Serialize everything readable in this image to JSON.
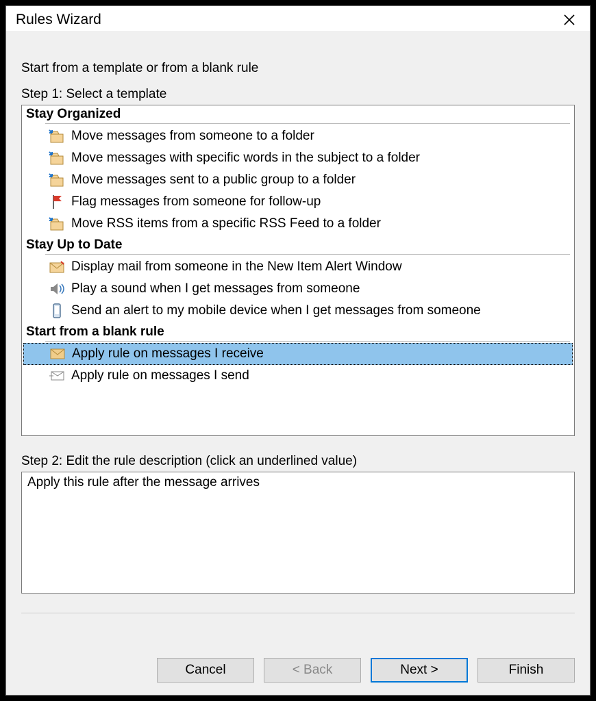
{
  "window": {
    "title": "Rules Wizard"
  },
  "instruction": "Start from a template or from a blank rule",
  "step1_label": "Step 1: Select a template",
  "groups": {
    "organized": "Stay Organized",
    "uptodate": "Stay Up to Date",
    "blank": "Start from a blank rule"
  },
  "templates": {
    "org1": "Move messages from someone to a folder",
    "org2": "Move messages with specific words in the subject to a folder",
    "org3": "Move messages sent to a public group to a folder",
    "org4": "Flag messages from someone for follow-up",
    "org5": "Move RSS items from a specific RSS Feed to a folder",
    "up1": "Display mail from someone in the New Item Alert Window",
    "up2": "Play a sound when I get messages from someone",
    "up3": "Send an alert to my mobile device when I get messages from someone",
    "bl1": "Apply rule on messages I receive",
    "bl2": "Apply rule on messages I send"
  },
  "step2_label": "Step 2: Edit the rule description (click an underlined value)",
  "description": "Apply this rule after the message arrives",
  "buttons": {
    "cancel": "Cancel",
    "back": "< Back",
    "next": "Next >",
    "finish": "Finish"
  }
}
